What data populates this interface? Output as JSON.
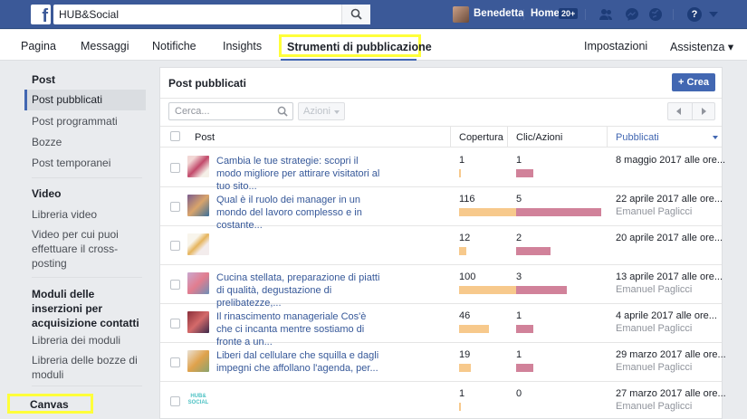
{
  "topbar": {
    "search_value": "HUB&Social",
    "user_name": "Benedetta",
    "home_label": "Home",
    "home_badge": "20+",
    "help_label": "?"
  },
  "page_nav": {
    "items": [
      "Pagina",
      "Messaggi",
      "Notifiche",
      "Insights"
    ],
    "active": "Strumenti di pubblicazione",
    "right": [
      "Impostazioni",
      "Assistenza ▾"
    ]
  },
  "sidebar": {
    "section_post": "Post",
    "post_items": [
      "Post pubblicati",
      "Post programmati",
      "Bozze",
      "Post temporanei"
    ],
    "section_video": "Video",
    "video_items": [
      "Libreria video",
      "Video per cui puoi effettuare il cross-posting"
    ],
    "section_leads": "Moduli delle inserzioni per acquisizione contatti",
    "lead_items": [
      "Libreria dei moduli",
      "Libreria delle bozze di moduli"
    ],
    "section_canvas": "Canvas"
  },
  "main": {
    "title": "Post pubblicati",
    "create_label": "+ Crea",
    "search_placeholder": "Cerca...",
    "actions_label": "Azioni",
    "columns": [
      "Post",
      "Copertura",
      "Clic/Azioni",
      "Pubblicati"
    ],
    "rows": [
      {
        "text": "Cambia le tue strategie: scopri il modo migliore per attirare visitatori al tuo sito...",
        "reach": "1",
        "clicks": "1",
        "date": "8 maggio 2017 alle ore...",
        "author": "",
        "reach_frac": 0.01,
        "click_frac": 0.2
      },
      {
        "text": "Qual è il ruolo dei manager in un mondo del lavoro complesso e in costante...",
        "reach": "116",
        "clicks": "5",
        "date": "22 aprile 2017 alle ore...",
        "author": "Emanuel Paglicci",
        "reach_frac": 1.0,
        "click_frac": 1.0
      },
      {
        "text": "",
        "reach": "12",
        "clicks": "2",
        "date": "20 aprile 2017 alle ore...",
        "author": "",
        "reach_frac": 0.1,
        "click_frac": 0.4
      },
      {
        "text": "Cucina stellata, preparazione di piatti di qualità, degustazione di prelibatezze,...",
        "reach": "100",
        "clicks": "3",
        "date": "13 aprile 2017 alle ore...",
        "author": "Emanuel Paglicci",
        "reach_frac": 0.86,
        "click_frac": 0.6
      },
      {
        "text": "Il rinascimento manageriale Cos'è che ci incanta mentre sostiamo di fronte a un...",
        "reach": "46",
        "clicks": "1",
        "date": "4 aprile 2017 alle ore...",
        "author": "Emanuel Paglicci",
        "reach_frac": 0.4,
        "click_frac": 0.2
      },
      {
        "text": "Liberi dal cellulare che squilla e dagli impegni che affollano l'agenda, per...",
        "reach": "19",
        "clicks": "1",
        "date": "29 marzo 2017 alle ore...",
        "author": "Emanuel Paglicci",
        "reach_frac": 0.16,
        "click_frac": 0.2
      },
      {
        "text": "",
        "reach": "1",
        "clicks": "0",
        "date": "27 marzo 2017 alle ore...",
        "author": "Emanuel Paglicci",
        "reach_frac": 0.01,
        "click_frac": 0.0
      }
    ],
    "thumb_logo_text": "HUB& SOCIAL"
  },
  "colors": {
    "brand": "#3b5998",
    "link": "#365899",
    "highlight": "#ffff3a",
    "reach_bar": "#f7c98c",
    "click_bar": "#d1829a"
  }
}
